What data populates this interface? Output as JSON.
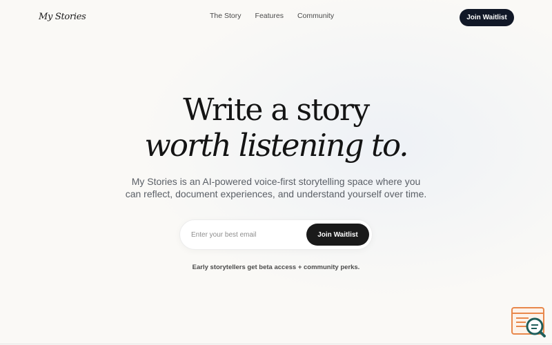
{
  "brand": {
    "logo": "My Stories"
  },
  "nav": {
    "links": [
      "The Story",
      "Features",
      "Community"
    ],
    "cta_label": "Join Waitlist"
  },
  "hero": {
    "title_line1": "Write a story",
    "title_line2": "worth listening to.",
    "subtitle": "My Stories is an AI-powered voice-first storytelling space where you can reflect, document experiences, and understand yourself over time."
  },
  "signup": {
    "email_placeholder": "Enter your best email",
    "cta_label": "Join Waitlist",
    "perks_text": "Early storytellers get beta access + community perks."
  },
  "widget": {
    "icon": "feedback-search-icon"
  },
  "colors": {
    "background": "#faf9f6",
    "button_dark": "#111827",
    "widget_orange": "#e8874a",
    "widget_teal": "#1f5e5a"
  }
}
